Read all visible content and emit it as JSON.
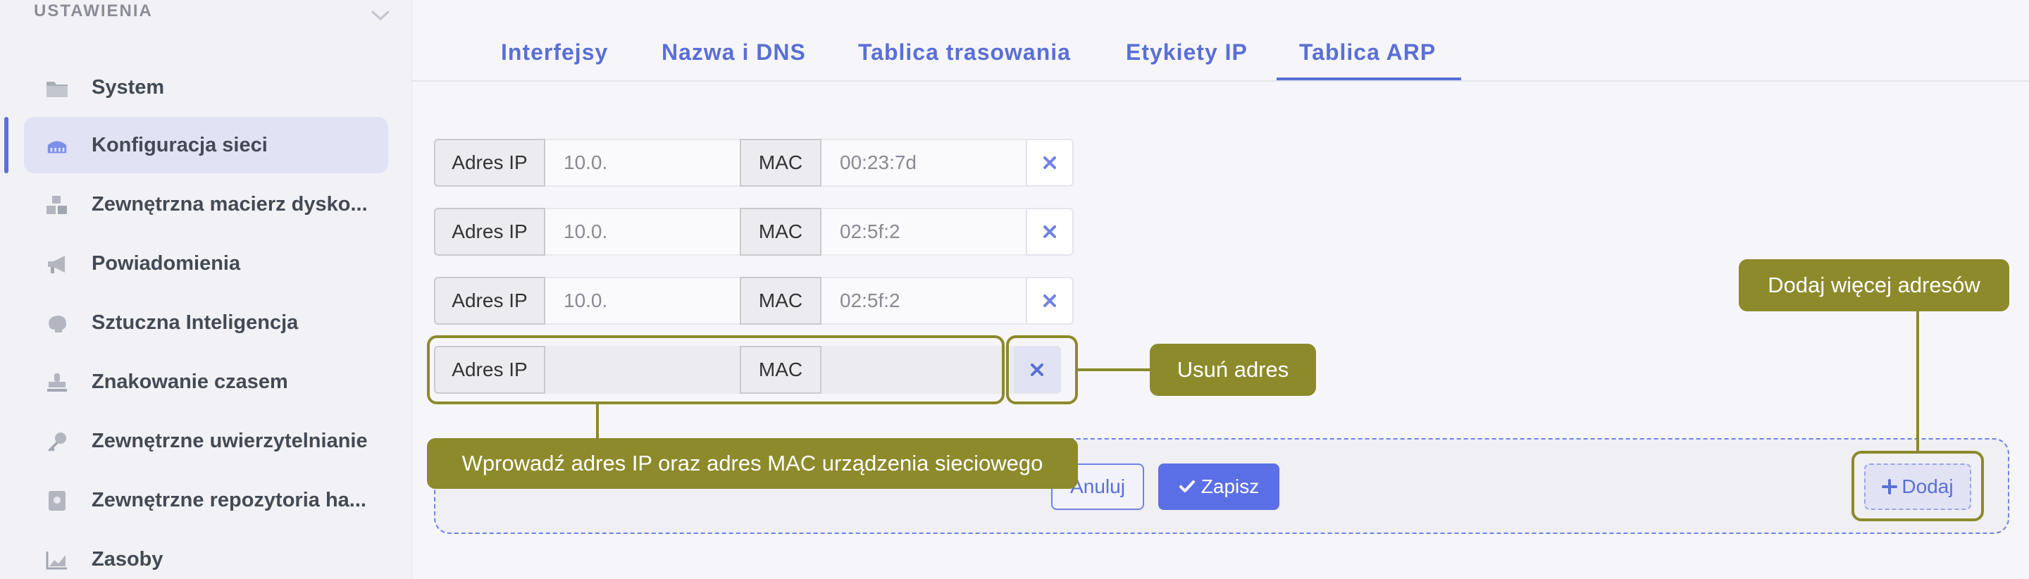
{
  "sidebar": {
    "header": "USTAWIENIA",
    "items": [
      {
        "label": "System",
        "icon": "folder-icon"
      },
      {
        "label": "Konfiguracja sieci",
        "icon": "network-icon"
      },
      {
        "label": "Zewnętrzna macierz dysko...",
        "icon": "boxes-icon"
      },
      {
        "label": "Powiadomienia",
        "icon": "megaphone-icon"
      },
      {
        "label": "Sztuczna Inteligencja",
        "icon": "brain-icon"
      },
      {
        "label": "Znakowanie czasem",
        "icon": "stamp-icon"
      },
      {
        "label": "Zewnętrzne uwierzytelnianie",
        "icon": "key-icon"
      },
      {
        "label": "Zewnętrzne repozytoria ha...",
        "icon": "vault-icon"
      },
      {
        "label": "Zasoby",
        "icon": "chart-icon"
      }
    ],
    "active_index": 1
  },
  "tabs": [
    {
      "label": "Interfejsy"
    },
    {
      "label": "Nazwa i DNS"
    },
    {
      "label": "Tablica trasowania"
    },
    {
      "label": "Etykiety IP"
    },
    {
      "label": "Tablica ARP"
    }
  ],
  "active_tab": "Tablica ARP",
  "arp_rows": [
    {
      "ip_label": "Adres IP",
      "ip_value": "10.0.",
      "mac_label": "MAC",
      "mac_value": "00:23:7d"
    },
    {
      "ip_label": "Adres IP",
      "ip_value": "10.0.",
      "mac_label": "MAC",
      "mac_value": "02:5f:2"
    },
    {
      "ip_label": "Adres IP",
      "ip_value": "10.0.",
      "mac_label": "MAC",
      "mac_value": "02:5f:2"
    },
    {
      "ip_label": "Adres IP",
      "ip_value": "",
      "mac_label": "MAC",
      "mac_value": ""
    }
  ],
  "actions": {
    "cancel": "Anuluj",
    "save": "Zapisz",
    "add": "Dodaj"
  },
  "callouts": {
    "remove": "Usuń adres",
    "add_more": "Dodaj więcej adresów",
    "enter": "Wprowadź adres IP oraz adres MAC urządzenia sieciowego"
  },
  "colors": {
    "accent": "#5a6fd6",
    "callout": "#8c8a2b"
  }
}
